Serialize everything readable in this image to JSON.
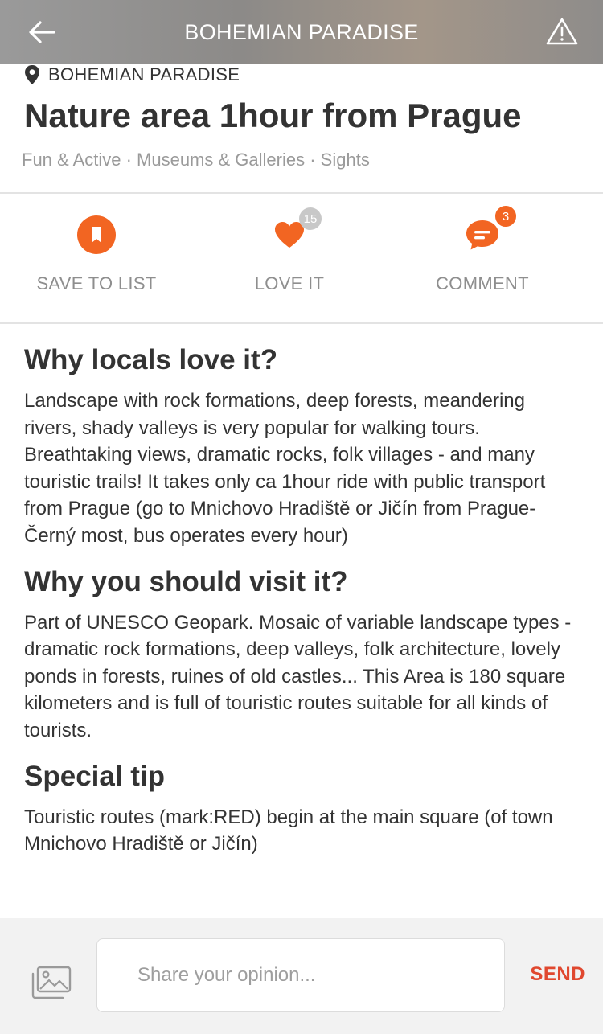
{
  "header": {
    "title": "BOHEMIAN PARADISE",
    "back_icon": "arrow-left-icon",
    "report_icon": "warning-triangle-icon"
  },
  "place": {
    "location_label": "BOHEMIAN PARADISE",
    "title": "Nature area 1hour from Prague",
    "categories": "Fun & Active · Museums & Galleries · Sights"
  },
  "actions": [
    {
      "label": "SAVE TO LIST",
      "icon": "bookmark-icon"
    },
    {
      "label": "LOVE IT",
      "icon": "heart-icon",
      "count": "15"
    },
    {
      "label": "COMMENT",
      "icon": "comment-icon",
      "count": "3"
    }
  ],
  "sections": [
    {
      "heading": "Why locals love it?",
      "body": "Landscape with rock formations, deep forests, meandering rivers, shady valleys is very popular for walking tours. Breathtaking views, dramatic rocks, folk villages - and many touristic trails! It takes only ca 1hour ride with public transport from Prague (go to Mnichovo Hradiště or Jičín from Prague- Černý most, bus operates every hour)"
    },
    {
      "heading": "Why you should visit it?",
      "body": "Part of UNESCO Geopark. Mosaic of variable landscape types - dramatic rock formations, deep valleys, folk architecture, lovely ponds in forests, ruines of old castles... This Area is 180 square kilometers and is full of touristic routes suitable for all kinds of tourists."
    },
    {
      "heading": "Special tip",
      "body": "Touristic routes (mark:RED)  begin at the main square (of town Mnichovo Hradiště or Jičín)"
    }
  ],
  "composer": {
    "placeholder": "Share your opinion...",
    "send_label": "SEND",
    "image_icon": "image-gallery-icon"
  },
  "colors": {
    "accent": "#f26522",
    "send": "#e0482f",
    "muted_text": "#8e8e8e"
  }
}
